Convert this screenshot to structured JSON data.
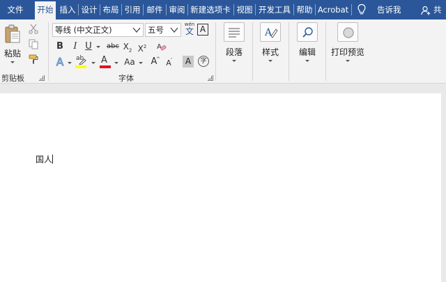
{
  "tabs": [
    {
      "label": "文件",
      "active": false
    },
    {
      "label": "开始",
      "active": true
    },
    {
      "label": "插入",
      "active": false
    },
    {
      "label": "设计",
      "active": false
    },
    {
      "label": "布局",
      "active": false
    },
    {
      "label": "引用",
      "active": false
    },
    {
      "label": "邮件",
      "active": false
    },
    {
      "label": "审阅",
      "active": false
    },
    {
      "label": "新建选项卡",
      "active": false
    },
    {
      "label": "视图",
      "active": false
    },
    {
      "label": "开发工具",
      "active": false
    },
    {
      "label": "帮助",
      "active": false
    },
    {
      "label": "Acrobat",
      "active": false
    }
  ],
  "tell_me": "告诉我",
  "share": "共",
  "clipboard": {
    "paste_label": "粘贴",
    "group_label": "剪贴板"
  },
  "font": {
    "font_name": "等线 (中文正文)",
    "font_size": "五号",
    "wen_top": "wén",
    "wen_char": "文",
    "boxed_a": "A",
    "bold": "B",
    "italic": "I",
    "underline": "U",
    "strike": "abc",
    "subscript": "X",
    "superscript": "X",
    "sub_mark": "2",
    "sup_mark": "2",
    "highlight_letters": "ab",
    "font_color_letter": "A",
    "change_case": "Aa",
    "grow_letter": "A",
    "shrink_letter": "A",
    "shade_letter": "A",
    "text_effect_letter": "A",
    "enclose_char": "字",
    "group_label": "字体"
  },
  "paragraph": {
    "label": "段落"
  },
  "styles": {
    "label": "样式"
  },
  "editing": {
    "label": "编辑"
  },
  "print_preview": {
    "label": "打印预览"
  },
  "document": {
    "text": "国人"
  },
  "colors": {
    "tab_bar": "#2b579a",
    "ribbon": "#f3f3f3",
    "highlight": "#ffff00",
    "font_color": "#e81123"
  }
}
